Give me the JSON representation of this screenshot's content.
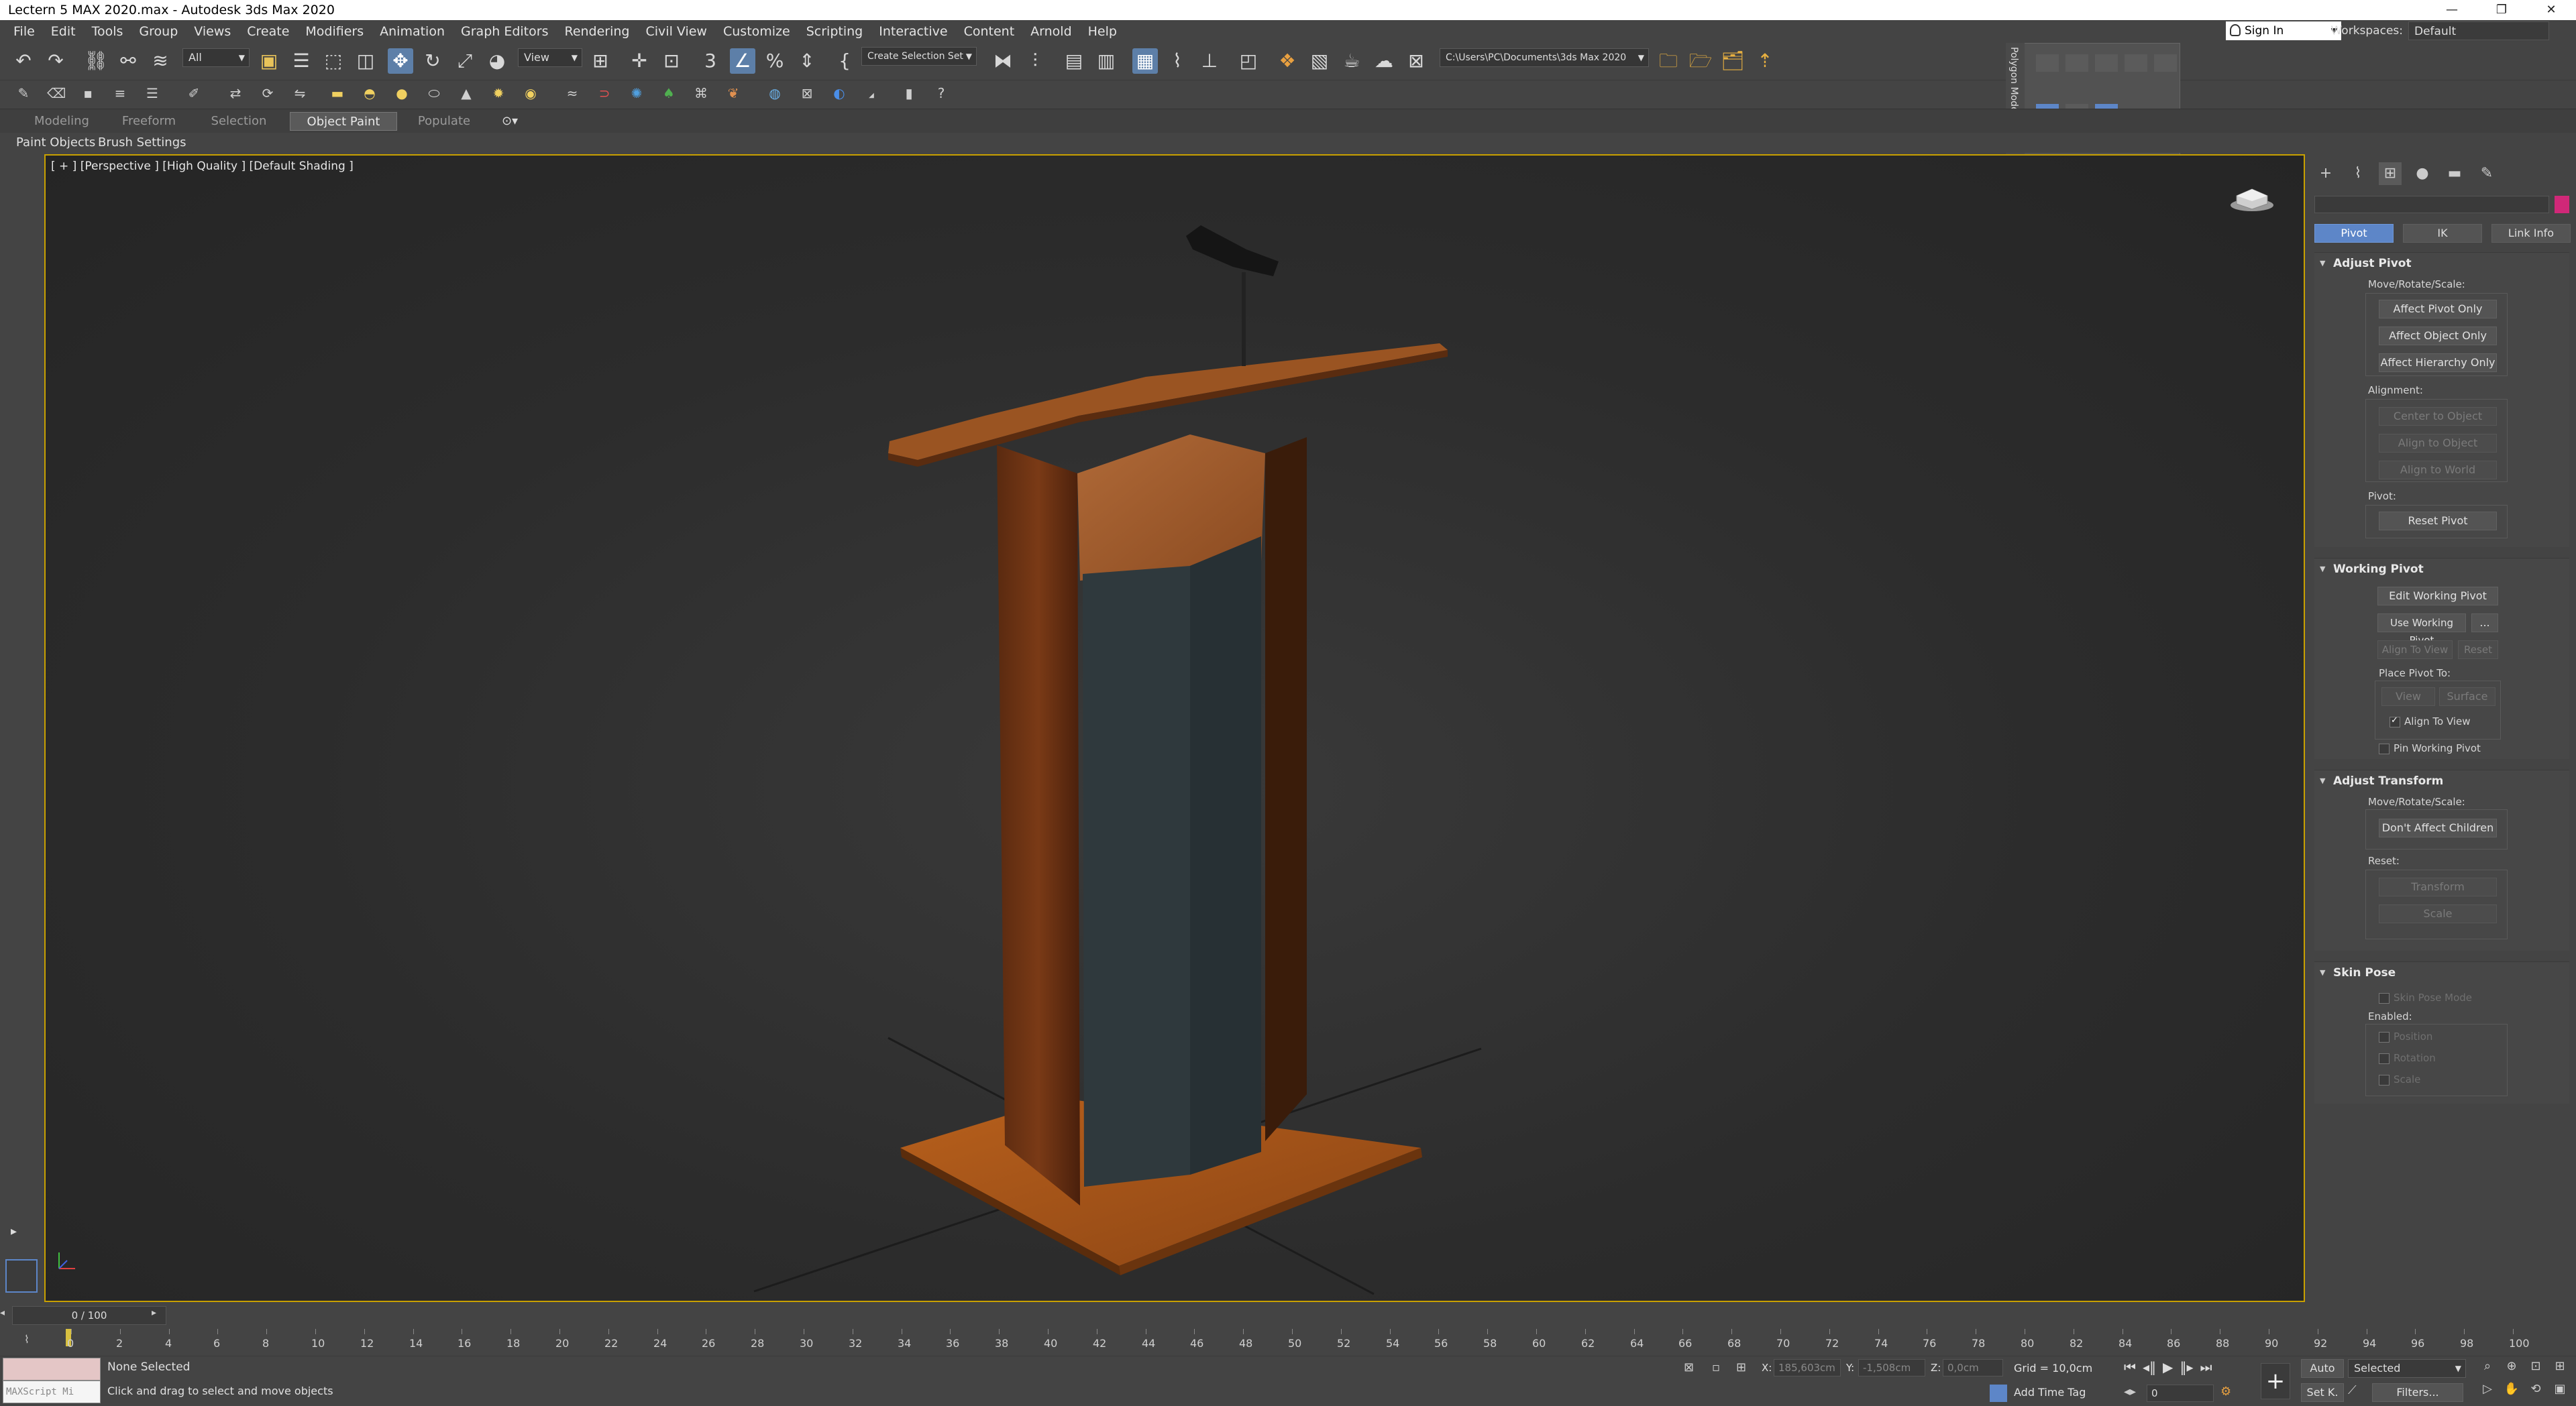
{
  "window": {
    "title": "Lectern 5 MAX 2020.max - Autodesk 3ds Max 2020"
  },
  "menu": [
    "File",
    "Edit",
    "Tools",
    "Group",
    "Views",
    "Create",
    "Modifiers",
    "Animation",
    "Graph Editors",
    "Rendering",
    "Civil View",
    "Customize",
    "Scripting",
    "Interactive",
    "Content",
    "Arnold",
    "Help"
  ],
  "account": {
    "sign_in": "Sign In",
    "workspaces_label": "Workspaces:",
    "workspaces_value": "Default"
  },
  "toolbar": {
    "selection_filter": "All",
    "ref_coord": "View",
    "named_selection": "Create Selection Set",
    "project_path": "C:\\Users\\PC\\Documents\\3ds Max 2020"
  },
  "ribbon": {
    "tabs": [
      "Modeling",
      "Freeform",
      "Selection",
      "Object Paint",
      "Populate"
    ],
    "active_tab": "Object Paint",
    "subtabs": [
      "Paint Objects",
      "Brush Settings"
    ]
  },
  "palette": {
    "title": "Polygon Modeling"
  },
  "viewport": {
    "label": "[ + ] [Perspective ] [High Quality ] [Default Shading ]"
  },
  "command_panel": {
    "hierarchy_buttons": [
      "Pivot",
      "IK",
      "Link Info"
    ],
    "active_button": "Pivot",
    "adjust_pivot": {
      "title": "Adjust Pivot",
      "move_label": "Move/Rotate/Scale:",
      "b1": "Affect Pivot Only",
      "b2": "Affect Object Only",
      "b3": "Affect Hierarchy Only",
      "alignment_label": "Alignment:",
      "a1": "Center to Object",
      "a2": "Align to Object",
      "a3": "Align to World",
      "pivot_label": "Pivot:",
      "reset": "Reset Pivot"
    },
    "working_pivot": {
      "title": "Working Pivot",
      "edit": "Edit Working Pivot",
      "use": "Use Working Pivot",
      "more": "...",
      "align_view": "Align To View",
      "reset": "Reset",
      "place_label": "Place Pivot To:",
      "view": "View",
      "surface": "Surface",
      "align_chk": "Align To View",
      "pin": "Pin Working Pivot"
    },
    "adjust_transform": {
      "title": "Adjust Transform",
      "move_label": "Move/Rotate/Scale:",
      "dont_affect": "Don't Affect Children",
      "reset_label": "Reset:",
      "transform": "Transform",
      "scale": "Scale"
    },
    "skin_pose": {
      "title": "Skin Pose",
      "mode": "Skin Pose Mode",
      "enabled_label": "Enabled:",
      "position": "Position",
      "rotation": "Rotation",
      "scale": "Scale"
    }
  },
  "timeline": {
    "slider": "0 / 100",
    "ticks": [
      "0",
      "2",
      "4",
      "6",
      "8",
      "10",
      "12",
      "14",
      "16",
      "18",
      "20",
      "22",
      "24",
      "26",
      "28",
      "30",
      "32",
      "34",
      "36",
      "38",
      "40",
      "42",
      "44",
      "46",
      "48",
      "50",
      "52",
      "54",
      "56",
      "58",
      "60",
      "62",
      "64",
      "66",
      "68",
      "70",
      "72",
      "74",
      "76",
      "78",
      "80",
      "82",
      "84",
      "86",
      "88",
      "90",
      "92",
      "94",
      "96",
      "98",
      "100"
    ]
  },
  "status": {
    "maxscript": "MAXScript Mi",
    "selection": "None Selected",
    "prompt": "Click and drag to select and move objects",
    "x_label": "X:",
    "x_val": "185,603cm",
    "y_label": "Y:",
    "y_val": "-1,508cm",
    "z_label": "Z:",
    "z_val": "0,0cm",
    "grid": "Grid = 10,0cm",
    "add_time_tag": "Add Time Tag",
    "auto": "Auto",
    "selected": "Selected",
    "set_key": "Set K.",
    "filters": "Filters...",
    "frame": "0"
  }
}
